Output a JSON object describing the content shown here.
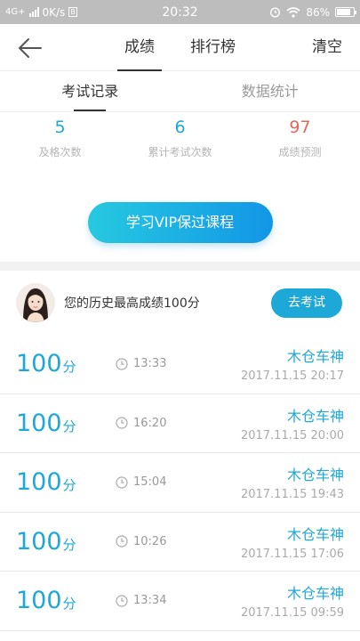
{
  "status_bar": {
    "network": "4G+",
    "speed": "0K/s",
    "time": "20:32",
    "battery": "86%",
    "battery_level": 0.86
  },
  "header": {
    "tabs": [
      {
        "label": "成绩",
        "active": true
      },
      {
        "label": "排行榜",
        "active": false
      }
    ],
    "clear_label": "清空"
  },
  "sub_tabs": [
    {
      "label": "考试记录",
      "active": true
    },
    {
      "label": "数据统计",
      "active": false
    }
  ],
  "stats": [
    {
      "value": "5",
      "label": "及格次数"
    },
    {
      "value": "6",
      "label": "累计考试次数"
    },
    {
      "value": "97",
      "label": "成绩预测"
    }
  ],
  "vip_button": "学习VIP保过课程",
  "best_score": {
    "text": "您的历史最高成绩100分",
    "button": "去考试"
  },
  "records": [
    {
      "score": "100",
      "unit": "分",
      "duration": "13:33",
      "user": "木仓车神",
      "date": "2017.11.15  20:17"
    },
    {
      "score": "100",
      "unit": "分",
      "duration": "16:20",
      "user": "木仓车神",
      "date": "2017.11.15  20:00"
    },
    {
      "score": "100",
      "unit": "分",
      "duration": "15:04",
      "user": "木仓车神",
      "date": "2017.11.15  19:43"
    },
    {
      "score": "100",
      "unit": "分",
      "duration": "10:26",
      "user": "木仓车神",
      "date": "2017.11.15  17:06"
    },
    {
      "score": "100",
      "unit": "分",
      "duration": "13:34",
      "user": "木仓车神",
      "date": "2017.11.15  09:59"
    }
  ],
  "colors": {
    "accent": "#1ea8d8",
    "prediction": "#e06a5c",
    "vip_gradient_start": "#26c9e0",
    "vip_gradient_end": "#1296e6"
  }
}
